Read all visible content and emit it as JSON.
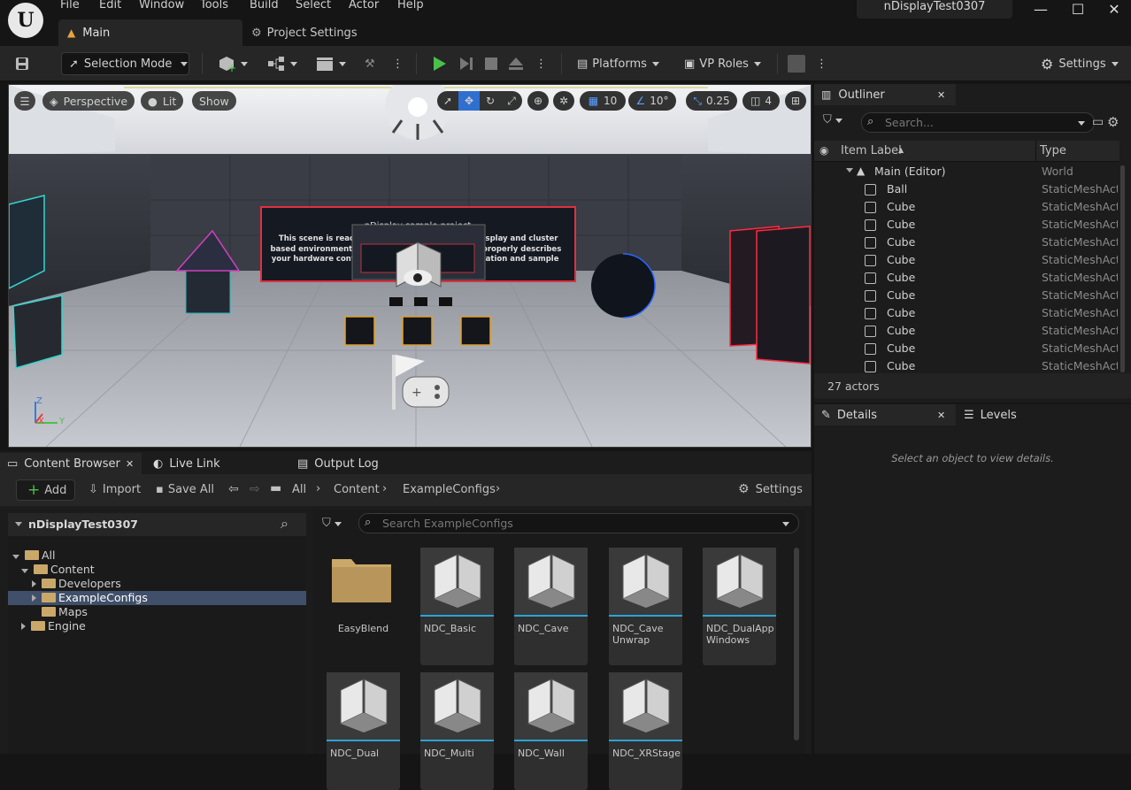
{
  "app": {
    "project_name": "nDisplayTest0307"
  },
  "menu": [
    "File",
    "Edit",
    "Window",
    "Tools",
    "Build",
    "Select",
    "Actor",
    "Help"
  ],
  "tabs": {
    "main": "Main",
    "project_settings": "Project Settings"
  },
  "toolbar": {
    "selection_mode": "Selection Mode",
    "platforms": "Platforms",
    "vp_roles": "VP Roles",
    "settings": "Settings"
  },
  "viewport": {
    "perspective": "Perspective",
    "lit": "Lit",
    "show": "Show",
    "grid_snap": "10",
    "rot_snap": "10°",
    "scale_snap": "0.25",
    "cam_speed": "4",
    "scene_title": "nDisplay sample project",
    "scene_lines": [
      "This scene is read",
      "display and cluster",
      "based environment. Y",
      "h properly describes",
      "your hardware config",
      "ntation and sample"
    ],
    "axis_z": "Z",
    "axis_x": "X",
    "axis_y": "Y"
  },
  "outliner": {
    "title": "Outliner",
    "search_placeholder": "Search...",
    "col_label": "Item Label",
    "col_type": "Type",
    "root": {
      "label": "Main (Editor)",
      "type": "World"
    },
    "rows": [
      {
        "label": "Ball",
        "type": "StaticMeshActor"
      },
      {
        "label": "Cube",
        "type": "StaticMeshActor"
      },
      {
        "label": "Cube",
        "type": "StaticMeshActor"
      },
      {
        "label": "Cube",
        "type": "StaticMeshActor"
      },
      {
        "label": "Cube",
        "type": "StaticMeshActor"
      },
      {
        "label": "Cube",
        "type": "StaticMeshActor"
      },
      {
        "label": "Cube",
        "type": "StaticMeshActor"
      },
      {
        "label": "Cube",
        "type": "StaticMeshActor"
      },
      {
        "label": "Cube",
        "type": "StaticMeshActor"
      },
      {
        "label": "Cube",
        "type": "StaticMeshActor"
      },
      {
        "label": "Cube",
        "type": "StaticMeshActor"
      }
    ],
    "count": "27 actors"
  },
  "details": {
    "tab": "Details",
    "levels_tab": "Levels",
    "empty": "Select an object to view details."
  },
  "content_browser": {
    "tab": "Content Browser",
    "live_link": "Live Link",
    "output_log": "Output Log",
    "add": "Add",
    "import": "Import",
    "save_all": "Save All",
    "settings": "Settings",
    "breadcrumb": [
      "All",
      "Content",
      "ExampleConfigs"
    ],
    "tree_root": "nDisplayTest0307",
    "tree": {
      "all": "All",
      "content": "Content",
      "developers": "Developers",
      "exampleconfigs": "ExampleConfigs",
      "maps": "Maps",
      "engine": "Engine"
    },
    "search_placeholder": "Search ExampleConfigs",
    "assets": [
      {
        "name": "EasyBlend",
        "kind": "folder"
      },
      {
        "name": "NDC_Basic",
        "kind": "config"
      },
      {
        "name": "NDC_Cave",
        "kind": "config"
      },
      {
        "name": "NDC_Cave Unwrap",
        "kind": "config"
      },
      {
        "name": "NDC_DualApp Windows",
        "kind": "config"
      },
      {
        "name": "NDC_Dual",
        "kind": "config"
      },
      {
        "name": "NDC_Multi",
        "kind": "config"
      },
      {
        "name": "NDC_Wall",
        "kind": "config"
      },
      {
        "name": "NDC_XRStage",
        "kind": "config"
      }
    ]
  }
}
